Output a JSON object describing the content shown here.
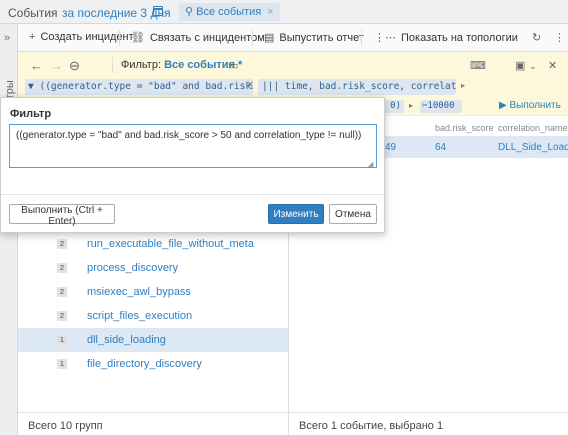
{
  "topbar": {
    "title": "События",
    "period": "за последние 3 дня",
    "tab_label": "Все события",
    "tab_close": "×"
  },
  "sidebar": {
    "collapse_glyph": "»",
    "vertical_label": "и фильтры"
  },
  "toolbar": {
    "create_incident": "Создать инцидент",
    "link_incident": "Связать с инцидентом",
    "run_report": "Выпустить отчет",
    "show_topology": "Показать на топологии"
  },
  "filter_header": {
    "label": "Фильтр:",
    "name": "Все события *"
  },
  "filter_expr": {
    "text": "((generator.type = \"bad\" and bad.risk…",
    "close": "×",
    "columns": "time, bad.risk_score, correlation_nam…"
  },
  "row2": {
    "count_partial": "0)",
    "limit": "10000",
    "execute": "Выполнить"
  },
  "table": {
    "columns": [
      "bad.risk_score",
      "correlation_name"
    ],
    "row": {
      "partial": "49",
      "risk": "64",
      "name": "DLL_Side_Loading"
    }
  },
  "groups": [
    {
      "count": "2",
      "name": "run_executable_file_without_meta"
    },
    {
      "count": "2",
      "name": "process_discovery"
    },
    {
      "count": "2",
      "name": "msiexec_awl_bypass"
    },
    {
      "count": "2",
      "name": "script_files_execution"
    },
    {
      "count": "1",
      "name": "dll_side_loading",
      "selected": true
    },
    {
      "count": "1",
      "name": "file_directory_discovery"
    }
  ],
  "footer": {
    "left": "Всего 10 групп",
    "right": "Всего 1 событие, выбрано 1"
  },
  "dialog": {
    "title": "Фильтр",
    "expression": "((generator.type = \"bad\" and bad.risk_score > 50 and correlation_type != null))",
    "run_button": "Выполнить (Ctrl + Enter)",
    "apply_button": "Изменить",
    "cancel_button": "Отмена"
  }
}
